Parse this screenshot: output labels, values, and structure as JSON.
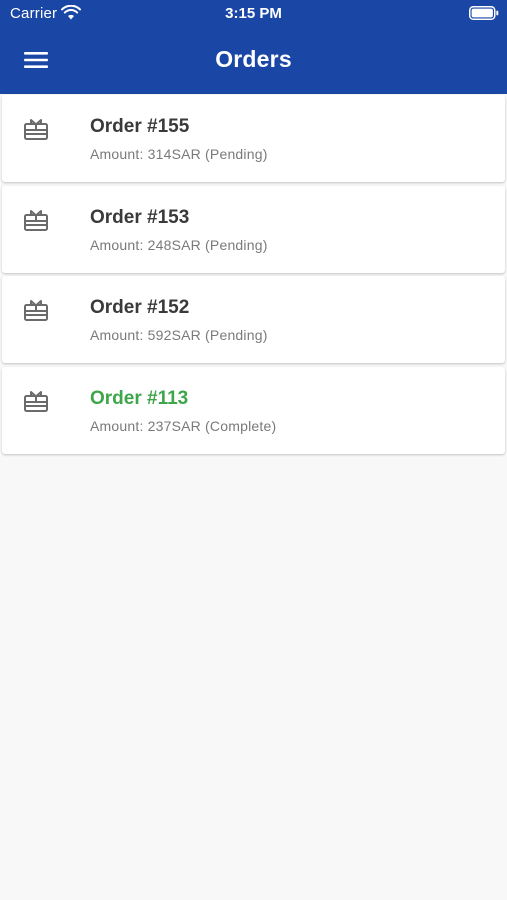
{
  "status_bar": {
    "carrier": "Carrier",
    "time": "3:15 PM",
    "wifi_icon": "wifi-icon",
    "battery_icon": "battery-icon"
  },
  "header": {
    "title": "Orders",
    "menu_icon": "hamburger-menu-icon",
    "background_color": "#1a47a6"
  },
  "colors": {
    "pending_title": "#3a3a3a",
    "complete_title": "#3ea64a"
  },
  "orders": [
    {
      "title": "Order #155",
      "subtitle": "Amount: 314SAR (Pending)",
      "status": "pending",
      "icon": "gift-card-icon"
    },
    {
      "title": "Order #153",
      "subtitle": "Amount: 248SAR (Pending)",
      "status": "pending",
      "icon": "gift-card-icon"
    },
    {
      "title": "Order #152",
      "subtitle": "Amount: 592SAR (Pending)",
      "status": "pending",
      "icon": "gift-card-icon"
    },
    {
      "title": "Order #113",
      "subtitle": "Amount: 237SAR (Complete)",
      "status": "complete",
      "icon": "gift-card-icon"
    }
  ]
}
